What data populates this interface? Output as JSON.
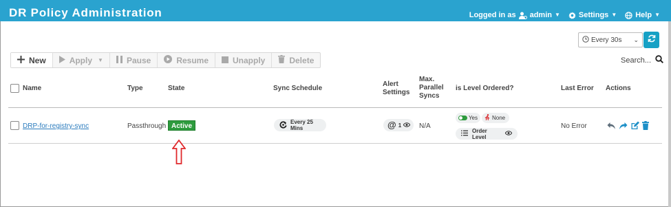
{
  "header": {
    "title": "DR Policy Administration",
    "logged_in_label": "Logged in as",
    "user": "admin",
    "settings_label": "Settings",
    "help_label": "Help"
  },
  "refresh": {
    "interval": "Every 30s"
  },
  "toolbar": {
    "new_label": "New",
    "apply_label": "Apply",
    "pause_label": "Pause",
    "resume_label": "Resume",
    "unapply_label": "Unapply",
    "delete_label": "Delete"
  },
  "search": {
    "label": "Search..."
  },
  "table": {
    "headers": {
      "name": "Name",
      "type": "Type",
      "state": "State",
      "sync_schedule": "Sync Schedule",
      "alert_settings_1": "Alert",
      "alert_settings_2": "Settings",
      "max_parallel_1": "Max.",
      "max_parallel_2": "Parallel",
      "max_parallel_3": "Syncs",
      "level_ordered": "is Level Ordered?",
      "last_error": "Last Error",
      "actions": "Actions"
    },
    "rows": [
      {
        "name": "DRP-for-registry-sync",
        "type": "Passthrough",
        "state": "Active",
        "sync_schedule": "Every 25 Mins",
        "alert_count": "1",
        "max_parallel": "N/A",
        "level_yes": "Yes",
        "level_none": "None",
        "order_level": "Order Level",
        "last_error": "No Error"
      }
    ]
  },
  "colors": {
    "header_bg": "#2aa3cf",
    "active_badge": "#2e9b3e",
    "link": "#2a7bbd",
    "action_icons": "#1c8fc7",
    "annotation_arrow": "#e0282b"
  }
}
